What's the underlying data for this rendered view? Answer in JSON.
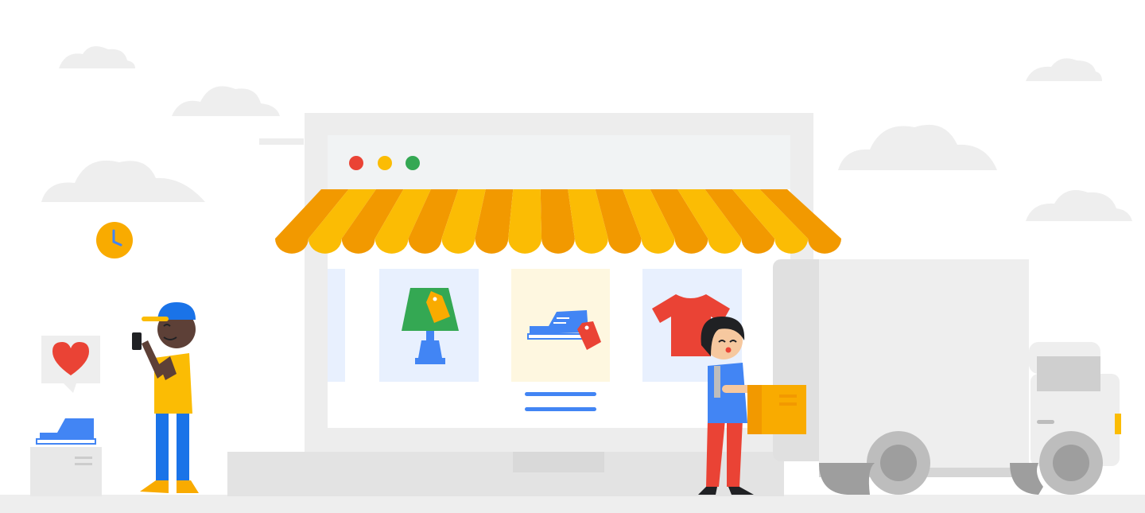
{
  "palette": {
    "background": "#ffffff",
    "cloud": "#eeeeee",
    "ground": "#eeeeee",
    "laptop_frame": "#ededed",
    "laptop_base": "#e3e3e3",
    "screen": "#ffffff",
    "browser_bar": "#f1f3f4",
    "dot_red": "#ea4335",
    "dot_yellow": "#fbbc04",
    "dot_green": "#34a853",
    "awning_orange": "#f29900",
    "awning_yellow": "#fbbc04",
    "card_blue": "#e8f0fe",
    "card_yellow": "#fef7e0",
    "lamp_green": "#34a853",
    "lamp_blue": "#4285f4",
    "shirt_red": "#ea4335",
    "tag_orange": "#f9ab00",
    "tag_red": "#ea4335",
    "shoe_blue": "#4285f4",
    "text_line": "#4285f4",
    "truck_body": "#e0e0e0",
    "truck_cab": "#eeeeee",
    "wheel_outer": "#bdbdbd",
    "wheel_inner": "#9e9e9e",
    "box": "#f9ab00",
    "clock": "#f9ab00",
    "heart": "#ea4335",
    "skin_dark": "#5d4037",
    "skin_light": "#f6c89f",
    "hair": "#202124",
    "shirt_yellow": "#fbbc04",
    "pants_blue": "#1a73e8",
    "pants_red": "#ea4335",
    "vest_blue": "#4285f4",
    "shoes_yellow": "#f9ab00"
  },
  "icons": {
    "clock": "clock-icon",
    "heart": "heart-icon",
    "lamp": "lamp-icon",
    "shoe": "sneaker-icon",
    "shirt": "t-shirt-icon",
    "tag": "price-tag-icon"
  },
  "products": [
    {
      "name": "lamp",
      "card_color": "#e8f0fe",
      "highlighted": false
    },
    {
      "name": "sneaker",
      "card_color": "#fef7e0",
      "highlighted": true
    },
    {
      "name": "t-shirt",
      "card_color": "#e8f0fe",
      "highlighted": false
    }
  ],
  "window_dots": [
    "#ea4335",
    "#fbbc04",
    "#34a853"
  ]
}
